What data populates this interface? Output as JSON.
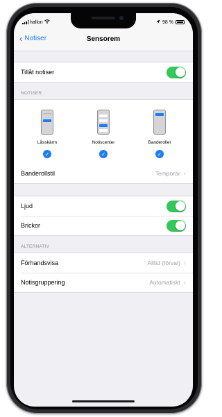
{
  "status_bar": {
    "carrier": "hallon",
    "battery": "98 %"
  },
  "nav": {
    "back_label": "Notiser",
    "title": "Sensorem"
  },
  "allow_notifications": {
    "label": "Tillåt notiser",
    "on": true
  },
  "notiser_section": {
    "header": "NOTISER",
    "styles": [
      {
        "label": "Låsskärm",
        "selected": true
      },
      {
        "label": "Notiscenter",
        "selected": true
      },
      {
        "label": "Banderoller",
        "selected": true
      }
    ],
    "banner_style": {
      "label": "Banderollstil",
      "value": "Temporär"
    }
  },
  "sound_badges": [
    {
      "label": "Ljud",
      "on": true
    },
    {
      "label": "Brickor",
      "on": true
    }
  ],
  "alternativ_section": {
    "header": "ALTERNATIV",
    "rows": [
      {
        "label": "Förhandsvisa",
        "value": "Alltid (förval)"
      },
      {
        "label": "Notisgruppering",
        "value": "Automatiskt"
      }
    ]
  },
  "colors": {
    "accent": "#1b7cf4",
    "toggle_on": "#34c759",
    "background": "#efeff4"
  }
}
